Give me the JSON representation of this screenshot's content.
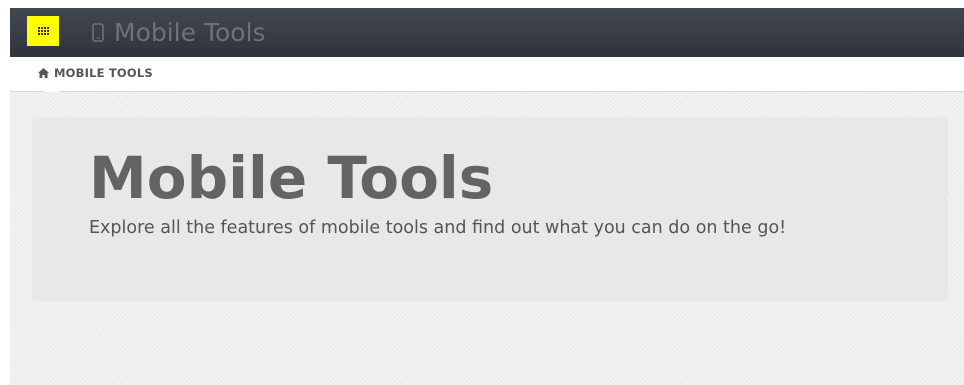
{
  "header": {
    "menu_icon": "grid-icon",
    "app_icon": "mobile-phone-icon",
    "title": "Mobile Tools",
    "menu_button_color": "#ffff00"
  },
  "breadcrumb": {
    "icon": "home-icon",
    "label": "MOBILE TOOLS"
  },
  "hero": {
    "title": "Mobile Tools",
    "subtitle": "Explore all the features of mobile tools and find out what you can do on the go!"
  }
}
